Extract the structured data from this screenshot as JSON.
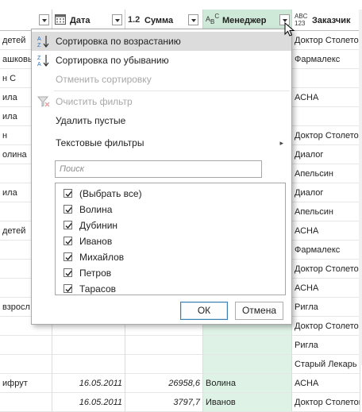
{
  "columns": [
    {
      "id": "c0",
      "label": ""
    },
    {
      "id": "date",
      "label": "Дата",
      "type_icon": "calendar-icon"
    },
    {
      "id": "sum",
      "label": "Сумма",
      "type_prefix": "1.2"
    },
    {
      "id": "manager",
      "label": "Менеджер",
      "type_prefix": "ABC"
    },
    {
      "id": "customer",
      "label": "Заказчик",
      "type_prefix": "ABC 123"
    }
  ],
  "rows": [
    {
      "c0": "детей",
      "date": "",
      "sum": "",
      "manager": "",
      "customer": "Доктор Столетов"
    },
    {
      "c0": "ашковы",
      "date": "",
      "sum": "",
      "manager": "",
      "customer": "Фармалекс"
    },
    {
      "c0": "н С",
      "date": "",
      "sum": "",
      "manager": "",
      "customer": ""
    },
    {
      "c0": "ила",
      "date": "",
      "sum": "",
      "manager": "",
      "customer": "АСНА"
    },
    {
      "c0": "ила",
      "date": "",
      "sum": "",
      "manager": "",
      "customer": ""
    },
    {
      "c0": "н",
      "date": "",
      "sum": "",
      "manager": "",
      "customer": "Доктор Столетов"
    },
    {
      "c0": "олина",
      "date": "",
      "sum": "",
      "manager": "",
      "customer": "Диалог"
    },
    {
      "c0": "",
      "date": "",
      "sum": "",
      "manager": "",
      "customer": "Апельсин"
    },
    {
      "c0": "ила",
      "date": "",
      "sum": "",
      "manager": "",
      "customer": "Диалог"
    },
    {
      "c0": "",
      "date": "",
      "sum": "",
      "manager": "",
      "customer": "Апельсин"
    },
    {
      "c0": "детей",
      "date": "",
      "sum": "",
      "manager": "",
      "customer": "АСНА"
    },
    {
      "c0": "",
      "date": "",
      "sum": "",
      "manager": "",
      "customer": "Фармалекс"
    },
    {
      "c0": "",
      "date": "",
      "sum": "",
      "manager": "",
      "customer": "Доктор Столетов"
    },
    {
      "c0": "",
      "date": "",
      "sum": "",
      "manager": "",
      "customer": "АСНА"
    },
    {
      "c0": "взросл",
      "date": "",
      "sum": "",
      "manager": "",
      "customer": "Ригла"
    },
    {
      "c0": "",
      "date": "",
      "sum": "",
      "manager": "",
      "customer": "Доктор Столетов"
    },
    {
      "c0": "",
      "date": "",
      "sum": "",
      "manager": "",
      "customer": "Ригла"
    },
    {
      "c0": "",
      "date": "",
      "sum": "",
      "manager": "",
      "customer": "Старый Лекарь"
    },
    {
      "c0": "ифрут",
      "date": "16.05.2011",
      "sum": "26958,6",
      "manager": "Волина",
      "customer": "АСНА"
    },
    {
      "c0": "",
      "date": "16.05.2011",
      "sum": "3797,7",
      "manager": "Иванов",
      "customer": "Доктор Столетов"
    }
  ],
  "menu": {
    "sort_asc": "Сортировка по возрастанию",
    "sort_desc": "Сортировка по убыванию",
    "cancel_sort": "Отменить сортировку",
    "clear_filter": "Очистить фильтр",
    "remove_empty": "Удалить пустые",
    "text_filters": "Текстовые фильтры",
    "search_placeholder": "Поиск",
    "ok": "ОК",
    "cancel": "Отмена"
  },
  "filter_items": [
    {
      "label": "(Выбрать все)",
      "checked": true
    },
    {
      "label": "Волина",
      "checked": true
    },
    {
      "label": "Дубинин",
      "checked": true
    },
    {
      "label": "Иванов",
      "checked": true
    },
    {
      "label": "Михайлов",
      "checked": true
    },
    {
      "label": "Петров",
      "checked": true
    },
    {
      "label": "Тарасов",
      "checked": true
    }
  ],
  "colors": {
    "selected_header": "#cfe9d8",
    "selected_cell": "#dff2e6",
    "highlight": "#dcdcdc",
    "ok_border": "#3c7fb1"
  }
}
